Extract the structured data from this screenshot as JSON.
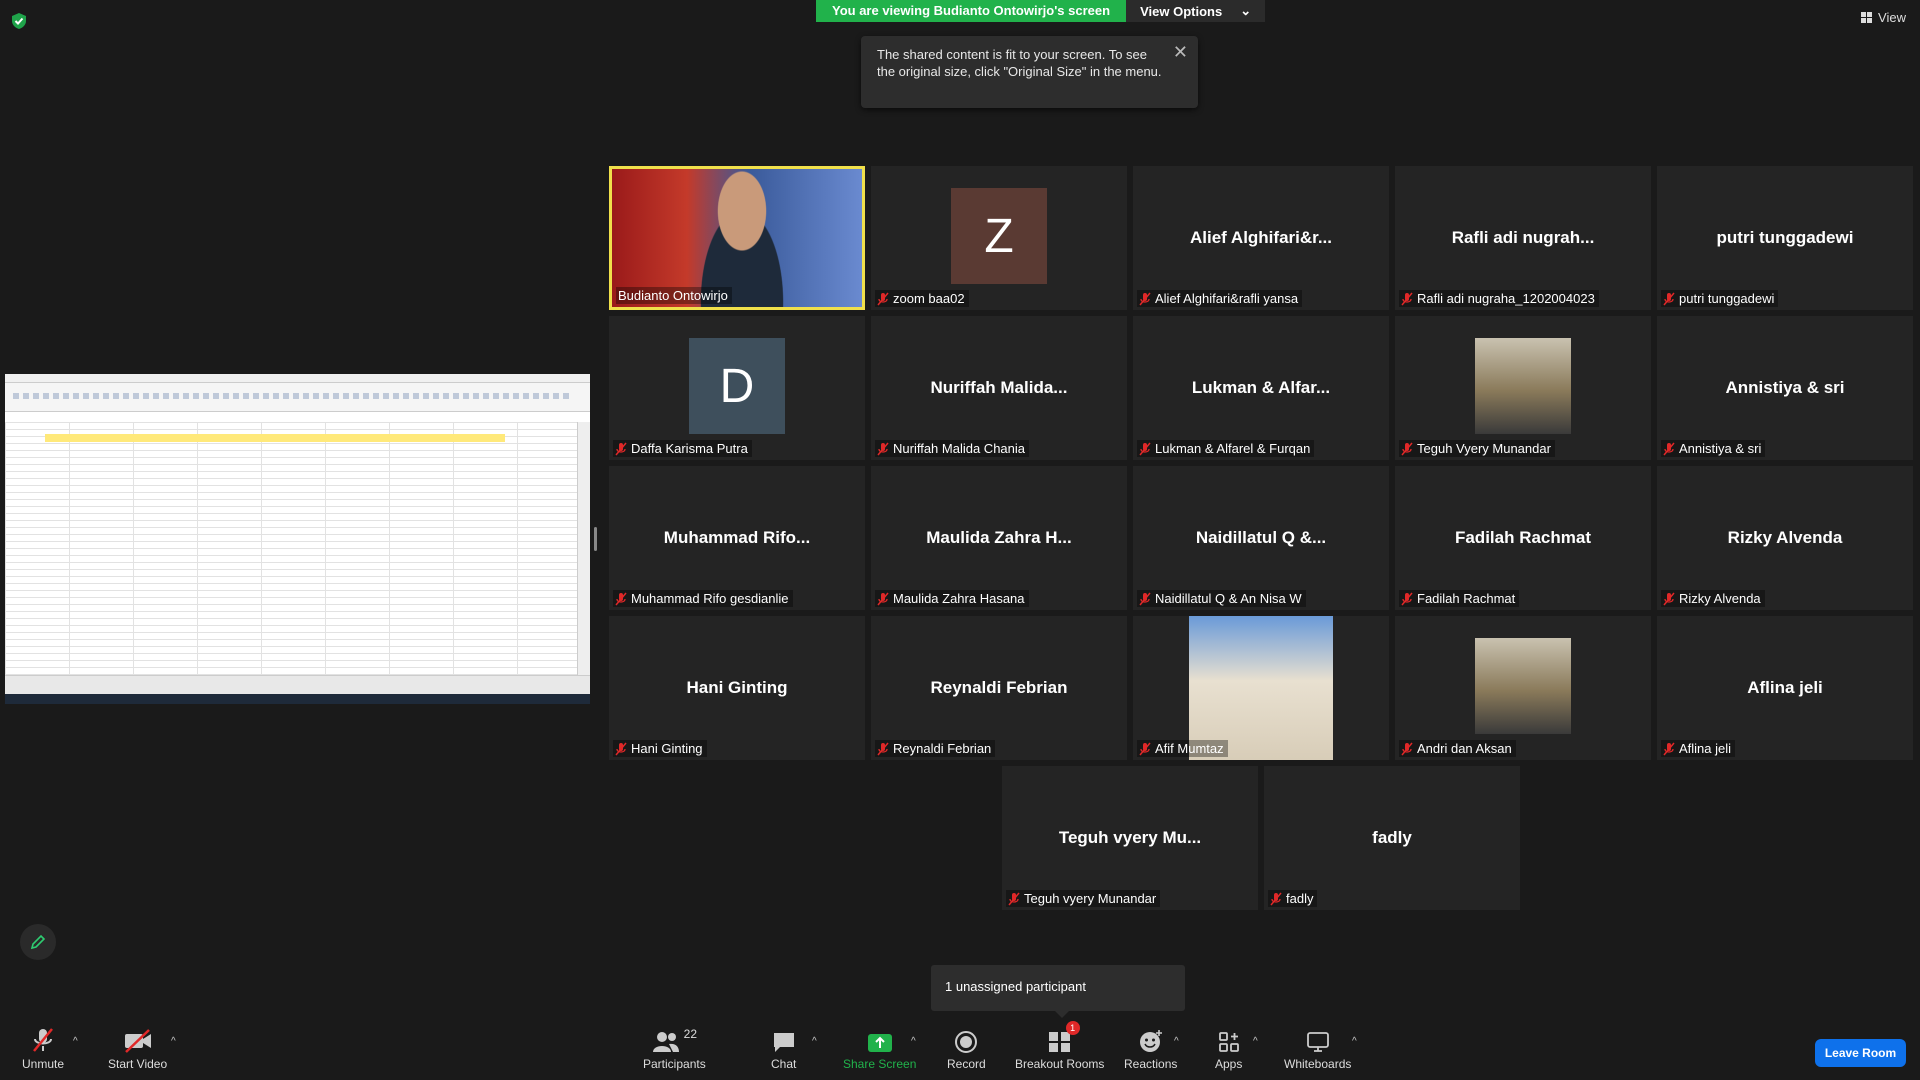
{
  "banner": {
    "viewing": "You are viewing Budianto Ontowirjo's screen",
    "options": "View Options"
  },
  "view_label": "View",
  "tooltip": "The shared content is fit to your screen. To see the original size, click \"Original Size\" in the menu.",
  "tiles": [
    {
      "big": "",
      "label": "Budianto Ontowirjo",
      "muted": false,
      "kind": "video"
    },
    {
      "big": "Z",
      "label": "zoom baa02",
      "muted": true,
      "kind": "avatar",
      "color": "#5a3a33"
    },
    {
      "big": "Alief Alghifari&r...",
      "label": "Alief Alghifari&rafli yansa",
      "muted": true,
      "kind": "name"
    },
    {
      "big": "Rafli adi nugrah...",
      "label": "Rafli adi nugraha_1202004023",
      "muted": true,
      "kind": "name"
    },
    {
      "big": "putri tunggadewi",
      "label": "putri tunggadewi",
      "muted": true,
      "kind": "name"
    },
    {
      "big": "D",
      "label": "Daffa Karisma Putra",
      "muted": true,
      "kind": "avatar",
      "color": "#3e4f5c"
    },
    {
      "big": "Nuriffah Malida...",
      "label": "Nuriffah Malida Chania",
      "muted": true,
      "kind": "name"
    },
    {
      "big": "Lukman & Alfar...",
      "label": "Lukman & Alfarel & Furqan",
      "muted": true,
      "kind": "name"
    },
    {
      "big": "",
      "label": "Teguh Vyery Munandar",
      "muted": true,
      "kind": "photo"
    },
    {
      "big": "Annistiya & sri",
      "label": "Annistiya & sri",
      "muted": true,
      "kind": "name"
    },
    {
      "big": "Muhammad Rifo...",
      "label": "Muhammad Rifo gesdianlie",
      "muted": true,
      "kind": "name"
    },
    {
      "big": "Maulida Zahra H...",
      "label": "Maulida Zahra Hasana",
      "muted": true,
      "kind": "name"
    },
    {
      "big": "Naidillatul Q &...",
      "label": "Naidillatul Q & An Nisa W",
      "muted": true,
      "kind": "name"
    },
    {
      "big": "Fadilah Rachmat",
      "label": "Fadilah Rachmat",
      "muted": true,
      "kind": "name"
    },
    {
      "big": "Rizky Alvenda",
      "label": "Rizky Alvenda",
      "muted": true,
      "kind": "name"
    },
    {
      "big": "Hani Ginting",
      "label": "Hani Ginting",
      "muted": true,
      "kind": "name"
    },
    {
      "big": "Reynaldi Febrian",
      "label": "Reynaldi Febrian",
      "muted": true,
      "kind": "name"
    },
    {
      "big": "",
      "label": "Afif Mumtaz",
      "muted": true,
      "kind": "photo"
    },
    {
      "big": "",
      "label": "Andri dan Aksan",
      "muted": true,
      "kind": "photo"
    },
    {
      "big": "Aflina jeli",
      "label": "Aflina jeli",
      "muted": true,
      "kind": "name"
    },
    {
      "big": "Teguh vyery Mu...",
      "label": "Teguh vyery Munandar",
      "muted": true,
      "kind": "name"
    },
    {
      "big": "fadly",
      "label": "fadly",
      "muted": true,
      "kind": "name"
    }
  ],
  "popup": "1 unassigned participant",
  "toolbar": {
    "unmute": "Unmute",
    "start_video": "Start Video",
    "participants": "Participants",
    "participants_count": "22",
    "chat": "Chat",
    "share_screen": "Share Screen",
    "record": "Record",
    "breakout": "Breakout Rooms",
    "breakout_badge": "1",
    "reactions": "Reactions",
    "apps": "Apps",
    "whiteboards": "Whiteboards",
    "leave": "Leave Room"
  },
  "colors": {
    "accent_green": "#21b24b",
    "active_border": "#f0e04b",
    "leave_blue": "#0e71eb",
    "mute_red": "#e02828"
  }
}
